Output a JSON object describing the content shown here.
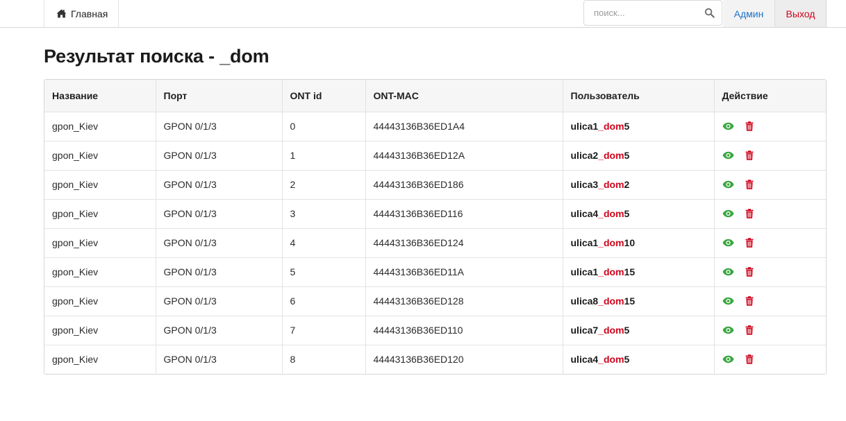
{
  "nav": {
    "home_label": "Главная",
    "search_placeholder": "поиск...",
    "admin_label": "Админ",
    "logout_label": "Выход"
  },
  "page_title": "Результат поиска - _dom",
  "search_term": "_dom",
  "colors": {
    "highlight": "#d0021b",
    "view_icon": "#3aa640",
    "delete_icon": "#d0021b",
    "link": "#1a73c9"
  },
  "table": {
    "headers": [
      "Название",
      "Порт",
      "ONT id",
      "ONT-MAC",
      "Пользователь",
      "Действие"
    ],
    "rows": [
      {
        "name": "gpon_Kiev",
        "port": "GPON 0/1/3",
        "ont_id": "0",
        "mac": "44443136B36ED1A4",
        "user_pre": "ulica1",
        "user_mid": "_dom",
        "user_post": "5"
      },
      {
        "name": "gpon_Kiev",
        "port": "GPON 0/1/3",
        "ont_id": "1",
        "mac": "44443136B36ED12A",
        "user_pre": "ulica2",
        "user_mid": "_dom",
        "user_post": "5"
      },
      {
        "name": "gpon_Kiev",
        "port": "GPON 0/1/3",
        "ont_id": "2",
        "mac": "44443136B36ED186",
        "user_pre": "ulica3",
        "user_mid": "_dom",
        "user_post": "2"
      },
      {
        "name": "gpon_Kiev",
        "port": "GPON 0/1/3",
        "ont_id": "3",
        "mac": "44443136B36ED116",
        "user_pre": "ulica4",
        "user_mid": "_dom",
        "user_post": "5"
      },
      {
        "name": "gpon_Kiev",
        "port": "GPON 0/1/3",
        "ont_id": "4",
        "mac": "44443136B36ED124",
        "user_pre": "ulica1",
        "user_mid": "_dom",
        "user_post": "10"
      },
      {
        "name": "gpon_Kiev",
        "port": "GPON 0/1/3",
        "ont_id": "5",
        "mac": "44443136B36ED11A",
        "user_pre": "ulica1",
        "user_mid": "_dom",
        "user_post": "15"
      },
      {
        "name": "gpon_Kiev",
        "port": "GPON 0/1/3",
        "ont_id": "6",
        "mac": "44443136B36ED128",
        "user_pre": "ulica8",
        "user_mid": "_dom",
        "user_post": "15"
      },
      {
        "name": "gpon_Kiev",
        "port": "GPON 0/1/3",
        "ont_id": "7",
        "mac": "44443136B36ED110",
        "user_pre": "ulica7",
        "user_mid": "_dom",
        "user_post": "5"
      },
      {
        "name": "gpon_Kiev",
        "port": "GPON 0/1/3",
        "ont_id": "8",
        "mac": "44443136B36ED120",
        "user_pre": "ulica4",
        "user_mid": "_dom",
        "user_post": "5"
      }
    ]
  }
}
